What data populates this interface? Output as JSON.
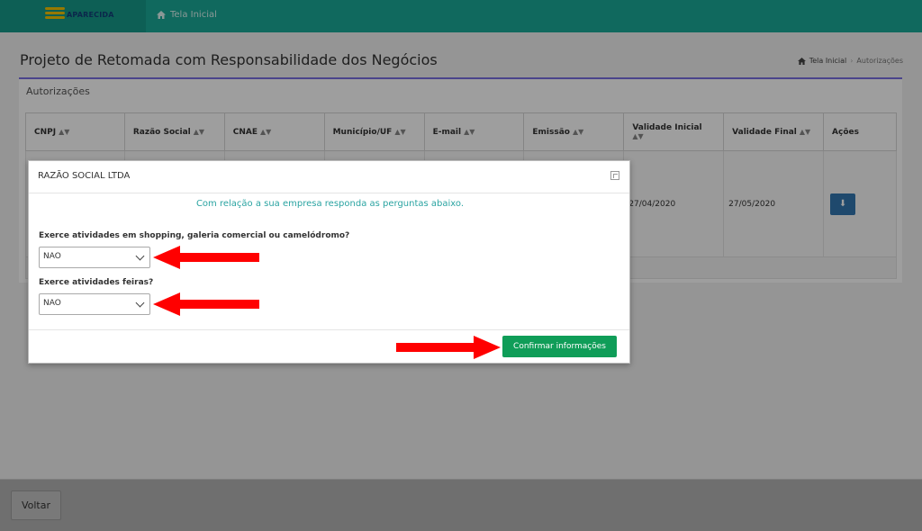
{
  "topbar": {
    "logo_text": "APARECIDA",
    "nav_home": "Tela Inicial"
  },
  "page": {
    "title": "Projeto de Retomada com Responsabilidade dos Negócios",
    "breadcrumb": [
      "Tela Inicial",
      "Autorizações"
    ]
  },
  "panel": {
    "title": "Autorizações",
    "columns": [
      "CNPJ",
      "Razão Social",
      "CNAE",
      "Município/UF",
      "E-mail",
      "Emissão",
      "Validade Inicial",
      "Validade Final",
      "Ações"
    ],
    "row": {
      "validade_inicial": "27/04/2020",
      "validade_final": "27/05/2020"
    }
  },
  "modal": {
    "title": "RAZÃO SOCIAL LTDA",
    "intro": "Com relação a sua empresa responda as perguntas abaixo.",
    "questions": [
      {
        "label": "Exerce atividades em shopping, galeria comercial ou camelódromo?",
        "value": "NAO"
      },
      {
        "label": "Exerce atividades feiras?",
        "value": "NAO"
      }
    ],
    "confirm_label": "Confirmar informações"
  },
  "footer": {
    "back_label": "Voltar"
  },
  "colors": {
    "topbar": "#1aaa98",
    "confirm": "#0f9d58",
    "arrow": "#ff0000",
    "intro_text": "#2ba4a2"
  }
}
